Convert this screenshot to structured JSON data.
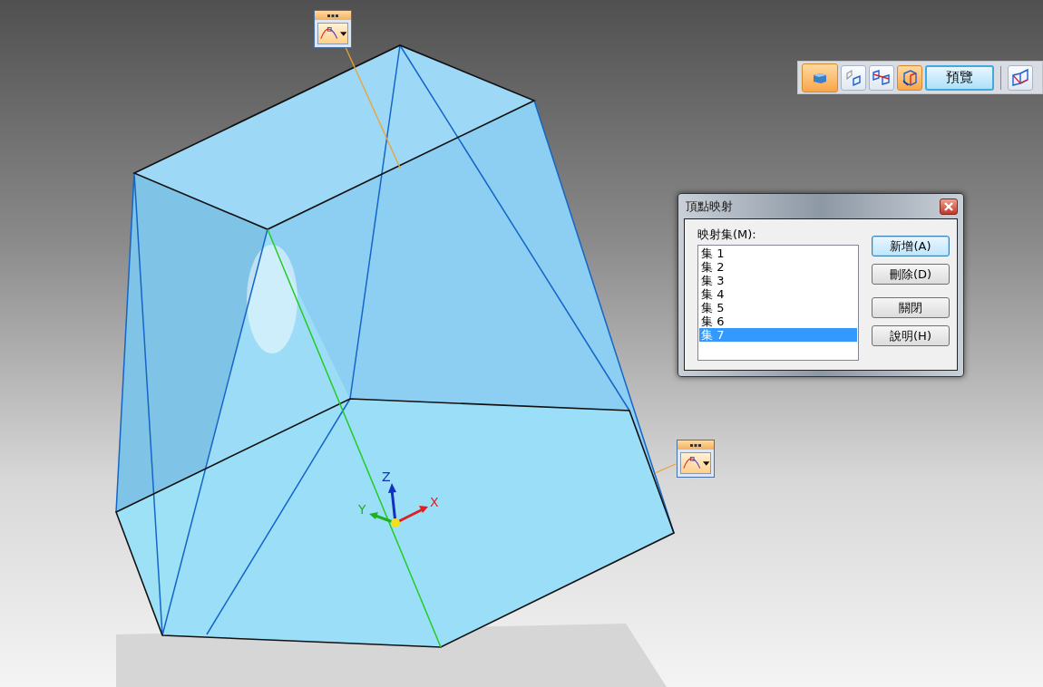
{
  "toolbar": {
    "buttons": [
      {
        "kind": "solid",
        "selected": true
      },
      {
        "kind": "step-one",
        "selected": false
      },
      {
        "kind": "step-two",
        "selected": false
      },
      {
        "kind": "step-three",
        "selected": true
      },
      {
        "kind": "text",
        "label": "預覽",
        "selected": false
      },
      {
        "kind": "view",
        "selected": false
      }
    ]
  },
  "triad": {
    "x": "X",
    "y": "Y",
    "z": "Z"
  },
  "dialog": {
    "title": "頂點映射",
    "list_label": "映射集(M):",
    "items": [
      {
        "label": "集 1",
        "selected": false
      },
      {
        "label": "集 2",
        "selected": false
      },
      {
        "label": "集 3",
        "selected": false
      },
      {
        "label": "集 4",
        "selected": false
      },
      {
        "label": "集 5",
        "selected": false
      },
      {
        "label": "集 6",
        "selected": false
      },
      {
        "label": "集 7",
        "selected": true
      }
    ],
    "buttons": [
      {
        "label": "新增(A)",
        "focused": true
      },
      {
        "label": "刪除(D)",
        "focused": false
      },
      {
        "label": "關閉",
        "focused": false
      },
      {
        "label": "說明(H)",
        "focused": false
      }
    ]
  }
}
